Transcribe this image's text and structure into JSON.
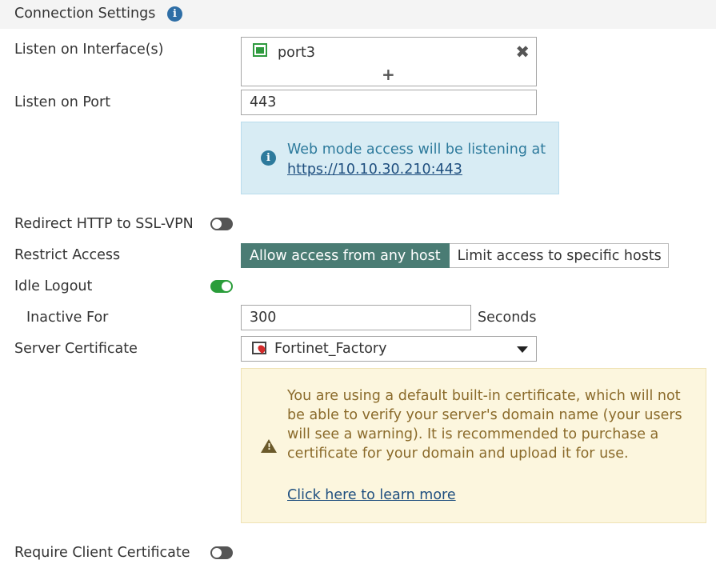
{
  "header": {
    "title": "Connection Settings",
    "info_icon": "info-circle-icon"
  },
  "listen_interfaces": {
    "label": "Listen on Interface(s)",
    "items": [
      {
        "name": "port3",
        "icon": "network-port-icon"
      }
    ],
    "add_symbol": "+",
    "remove_symbol": "✖"
  },
  "listen_port": {
    "label": "Listen on Port",
    "value": "443",
    "info_text": "Web mode access will be listening at",
    "info_link": "https://10.10.30.210:443"
  },
  "redirect_http": {
    "label": "Redirect HTTP to SSL-VPN",
    "enabled": false
  },
  "restrict_access": {
    "label": "Restrict Access",
    "options": [
      "Allow access from any host",
      "Limit access to specific hosts"
    ],
    "selected": "Allow access from any host"
  },
  "idle_logout": {
    "label": "Idle Logout",
    "enabled": true
  },
  "inactive_for": {
    "label": "Inactive For",
    "value": "300",
    "unit": "Seconds"
  },
  "server_certificate": {
    "label": "Server Certificate",
    "selected": "Fortinet_Factory",
    "icon": "certificate-icon",
    "warning_text": "You are using a default built-in certificate, which will not be able to verify your server's domain name (your users will see a warning). It is recommended to purchase a certificate for your domain and upload it for use.",
    "learn_more_link": "Click here to learn more"
  },
  "require_client_certificate": {
    "label": "Require Client Certificate",
    "enabled": false
  },
  "colors": {
    "accent": "#4a7c74",
    "toggle_on": "#2a9d3a",
    "info_bg": "#d8ecf4",
    "warning_bg": "#fcf6de"
  }
}
